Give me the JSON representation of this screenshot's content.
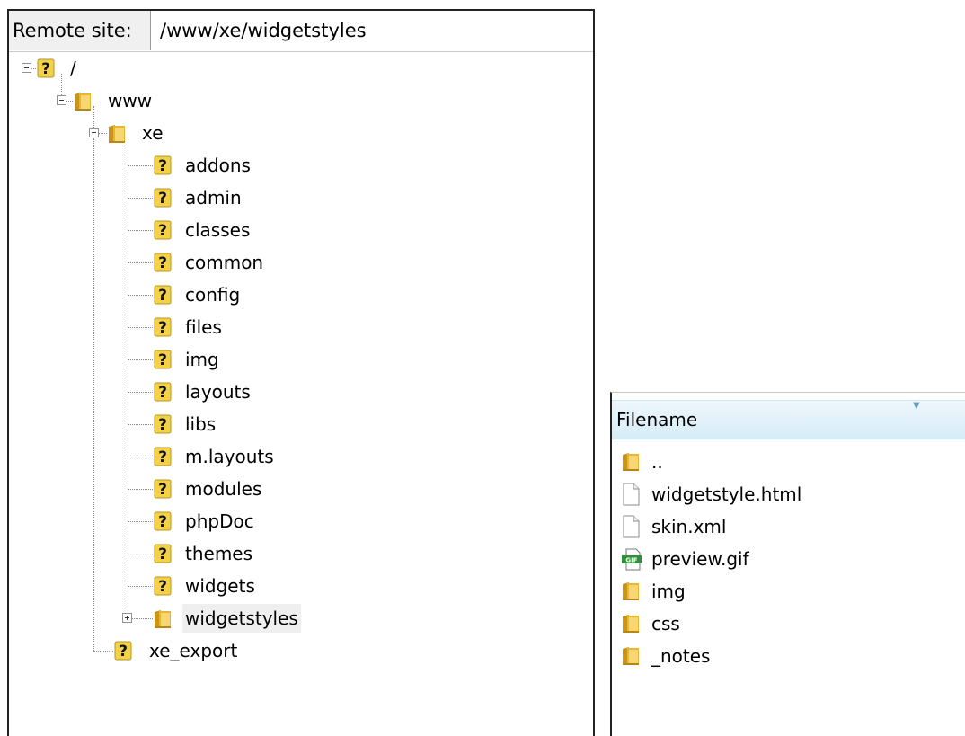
{
  "remote_site": {
    "label": "Remote site:",
    "path": "/www/xe/widgetstyles"
  },
  "tree": {
    "root": "/",
    "www": "www",
    "xe": "xe",
    "xe_children": [
      "addons",
      "admin",
      "classes",
      "common",
      "config",
      "files",
      "img",
      "layouts",
      "libs",
      "m.layouts",
      "modules",
      "phpDoc",
      "themes",
      "widgets",
      "widgetstyles"
    ],
    "selected": "widgetstyles",
    "xe_export": "xe_export"
  },
  "file_list": {
    "column_header": "Filename",
    "files": [
      {
        "name": "..",
        "icon": "folder-icon"
      },
      {
        "name": "widgetstyle.html",
        "icon": "file-icon"
      },
      {
        "name": "skin.xml",
        "icon": "file-icon"
      },
      {
        "name": "preview.gif",
        "icon": "gif-image-icon"
      },
      {
        "name": "img",
        "icon": "folder-icon"
      },
      {
        "name": "css",
        "icon": "folder-icon"
      },
      {
        "name": "_notes",
        "icon": "folder-icon"
      }
    ]
  },
  "colors": {
    "folder": "#e8b72e",
    "question_badge": "#f3d24a",
    "header": "#dcedf8",
    "selection": "#efefef"
  }
}
